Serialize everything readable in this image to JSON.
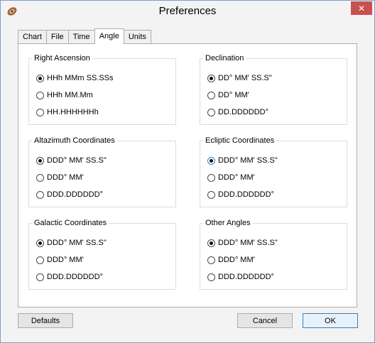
{
  "window": {
    "title": "Preferences",
    "close_label": "✕"
  },
  "tabs": [
    {
      "label": "Chart"
    },
    {
      "label": "File"
    },
    {
      "label": "Time"
    },
    {
      "label": "Angle"
    },
    {
      "label": "Units"
    }
  ],
  "active_tab": "Angle",
  "groups": {
    "right_ascension": {
      "title": "Right Ascension",
      "options": [
        "HHh MMm SS.SSs",
        "HHh MM.Mm",
        "HH.HHHHHHh"
      ],
      "selected": 0
    },
    "declination": {
      "title": "Declination",
      "options": [
        "DD° MM' SS.S\"",
        "DD° MM'",
        "DD.DDDDDD°"
      ],
      "selected": 0
    },
    "altazimuth": {
      "title": "Altazimuth Coordinates",
      "options": [
        "DDD° MM' SS.S\"",
        "DDD° MM'",
        "DDD.DDDDDD°"
      ],
      "selected": 0
    },
    "ecliptic": {
      "title": "Ecliptic Coordinates",
      "options": [
        "DDD° MM' SS.S\"",
        "DDD° MM'",
        "DDD.DDDDDD°"
      ],
      "selected": 0
    },
    "galactic": {
      "title": "Galactic Coordinates",
      "options": [
        "DDD° MM' SS.S\"",
        "DDD° MM'",
        "DDD.DDDDDD°"
      ],
      "selected": 0
    },
    "other": {
      "title": "Other Angles",
      "options": [
        "DDD° MM' SS.S\"",
        "DDD° MM'",
        "DDD.DDDDDD°"
      ],
      "selected": 0
    }
  },
  "buttons": {
    "defaults": "Defaults",
    "cancel": "Cancel",
    "ok": "OK"
  }
}
